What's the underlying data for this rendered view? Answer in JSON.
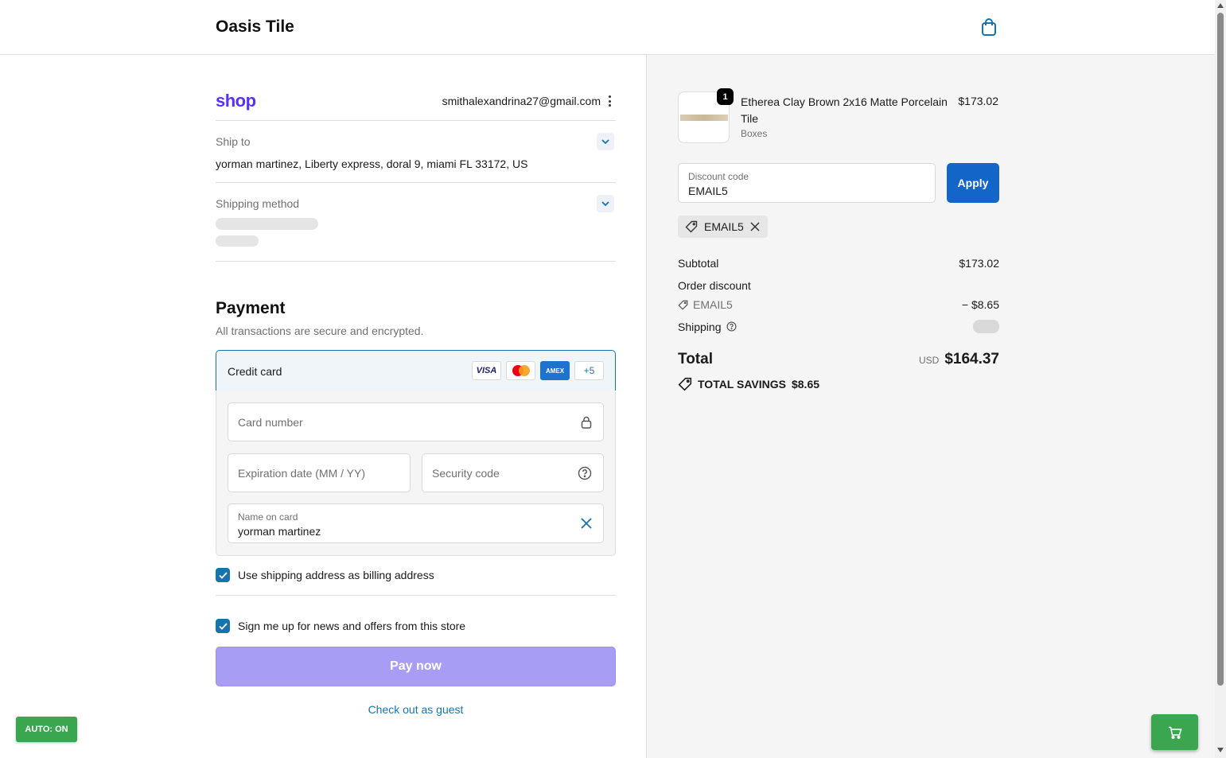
{
  "header": {
    "store_name": "Oasis Tile",
    "cart_icon": "shopping-bag-icon"
  },
  "account": {
    "shop_logo": "shop",
    "email": "smithalexandrina27@gmail.com"
  },
  "ship_to": {
    "label": "Ship to",
    "value": "yorman martinez, Liberty express, doral 9, miami FL 33172, US"
  },
  "shipping_method": {
    "label": "Shipping method",
    "loading": true
  },
  "payment": {
    "title": "Payment",
    "subtitle": "All transactions are secure and encrypted.",
    "method_label": "Credit card",
    "card_brands": [
      "VISA",
      "Mastercard",
      "AMEX",
      "+5"
    ],
    "card_number_placeholder": "Card number",
    "expiration_placeholder": "Expiration date (MM / YY)",
    "security_placeholder": "Security code",
    "name_label": "Name on card",
    "name_value": "yorman martinez"
  },
  "checkboxes": {
    "billing": {
      "label": "Use shipping address as billing address",
      "checked": true
    },
    "newsletter": {
      "label": "Sign me up for news and offers from this store",
      "checked": true
    }
  },
  "actions": {
    "pay_now": "Pay now",
    "guest": "Check out as guest"
  },
  "extension": {
    "auto_badge": "AUTO: ON"
  },
  "summary": {
    "item": {
      "quantity": "1",
      "title": "Etherea Clay Brown 2x16 Matte Porcelain Tile",
      "variant": "Boxes",
      "price": "$173.02"
    },
    "discount": {
      "label": "Discount code",
      "value": "EMAIL5",
      "apply": "Apply",
      "applied_tag": "EMAIL5"
    },
    "subtotal_label": "Subtotal",
    "subtotal_value": "$173.02",
    "order_discount_label": "Order discount",
    "discount_code": "EMAIL5",
    "discount_value": "− $8.65",
    "shipping_label": "Shipping",
    "total_label": "Total",
    "currency": "USD",
    "total_value": "$164.37",
    "savings_label": "TOTAL SAVINGS",
    "savings_value": "$8.65"
  },
  "colors": {
    "accent": "#1773b0",
    "apply": "#1366c7",
    "pay_button": "#a89df5",
    "shop_purple": "#5a31f4",
    "badge_green": "#3aa650"
  }
}
